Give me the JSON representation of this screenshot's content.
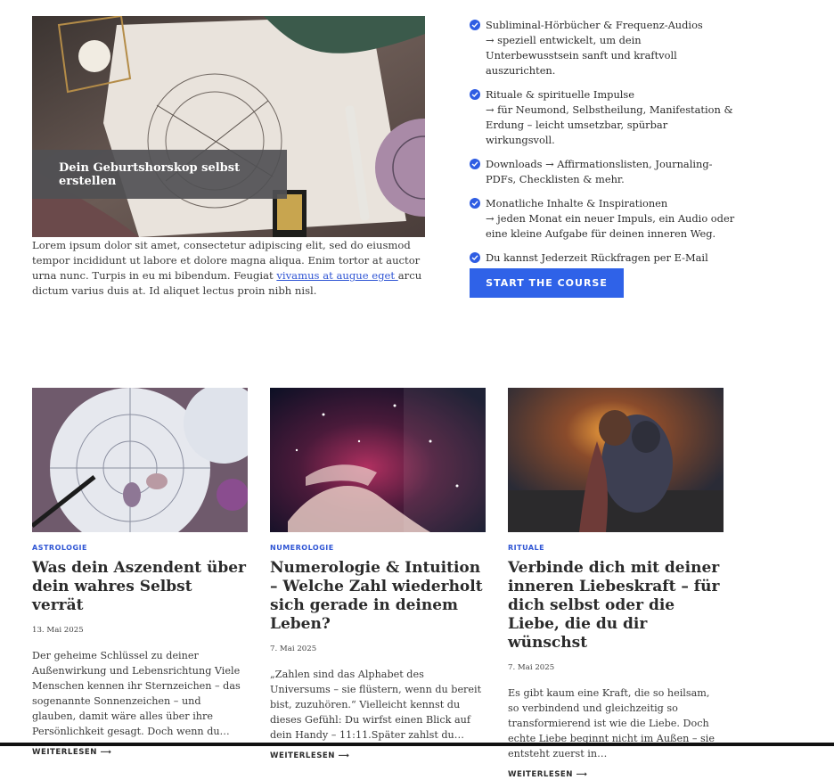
{
  "hero": {
    "overlay_title": "Dein Geburtshorskop selbst erstellen",
    "intro_text": "Lorem ipsum dolor sit amet, consectetur adipiscing elit, sed do eiusmod tempor incididunt ut labore et dolore magna aliqua. Enim tortor at auctor urna nunc. Turpis in eu mi bibendum. Feugiat ",
    "intro_link": "vivamus at augue eget ",
    "intro_text_end": "arcu dictum varius duis at. Id aliquet lectus proin nibh nisl."
  },
  "features": [
    {
      "line1": "Subliminal-Hörbücher & Frequenz-Audios",
      "line2": "→ speziell entwickelt, um dein Unterbewusstsein sanft und kraftvoll auszurichten."
    },
    {
      "line1": "Rituale & spirituelle Impulse",
      "line2": "→ für Neumond, Selbstheilung, Manifestation & Erdung – leicht umsetzbar, spürbar wirkungsvoll."
    },
    {
      "line1": "Downloads → Affirmationslisten, Journaling-PDFs, Checklisten & mehr.",
      "line2": ""
    },
    {
      "line1": "Monatliche Inhalte & Inspirationen",
      "line2": "→ jeden Monat ein neuer Impuls, ein Audio oder eine kleine Aufgabe für deinen inneren Weg."
    },
    {
      "line1": "Du kannst Jederzeit Rückfragen per E-Mail stellen",
      "line2": ""
    }
  ],
  "cta_label": "START THE COURSE",
  "colors": {
    "accent": "#2f62e8",
    "link": "#2f55d4",
    "overlay": "#505054"
  },
  "posts": [
    {
      "category": "ASTROLOGIE",
      "title": "Was dein Aszendent über dein wahres Selbst verrät",
      "date": "13. Mai 2025",
      "excerpt": "Der geheime Schlüssel zu deiner Außenwirkung und Lebensrichtung Viele Menschen kennen ihr Sternzeichen – das sogenannte Sonnenzeichen – und glauben, damit wäre alles über ihre Persönlichkeit gesagt. Doch wenn du…",
      "more": "WEITERLESEN ⟶"
    },
    {
      "category": "NUMEROLOGIE",
      "title": "Numerologie & Intuition – Welche Zahl wiederholt sich gerade in deinem Leben?",
      "date": "7. Mai 2025",
      "excerpt": "„Zahlen sind das Alphabet des Universums – sie flüstern, wenn du bereit bist, zuzuhören.“ Vielleicht kennst du dieses Gefühl: Du wirfst einen Blick auf dein Handy – 11:11.Später zahlst du…",
      "more": "WEITERLESEN ⟶"
    },
    {
      "category": "RITUALE",
      "title": "Verbinde dich mit deiner inneren Liebeskraft – für dich selbst oder die Liebe, die du dir wünschst",
      "date": "7. Mai 2025",
      "excerpt": "Es gibt kaum eine Kraft, die so heilsam, so verbindend und gleichzeitig so transformierend ist wie die Liebe. Doch echte Liebe beginnt nicht im Außen – sie entsteht zuerst in…",
      "more": "WEITERLESEN ⟶"
    }
  ]
}
